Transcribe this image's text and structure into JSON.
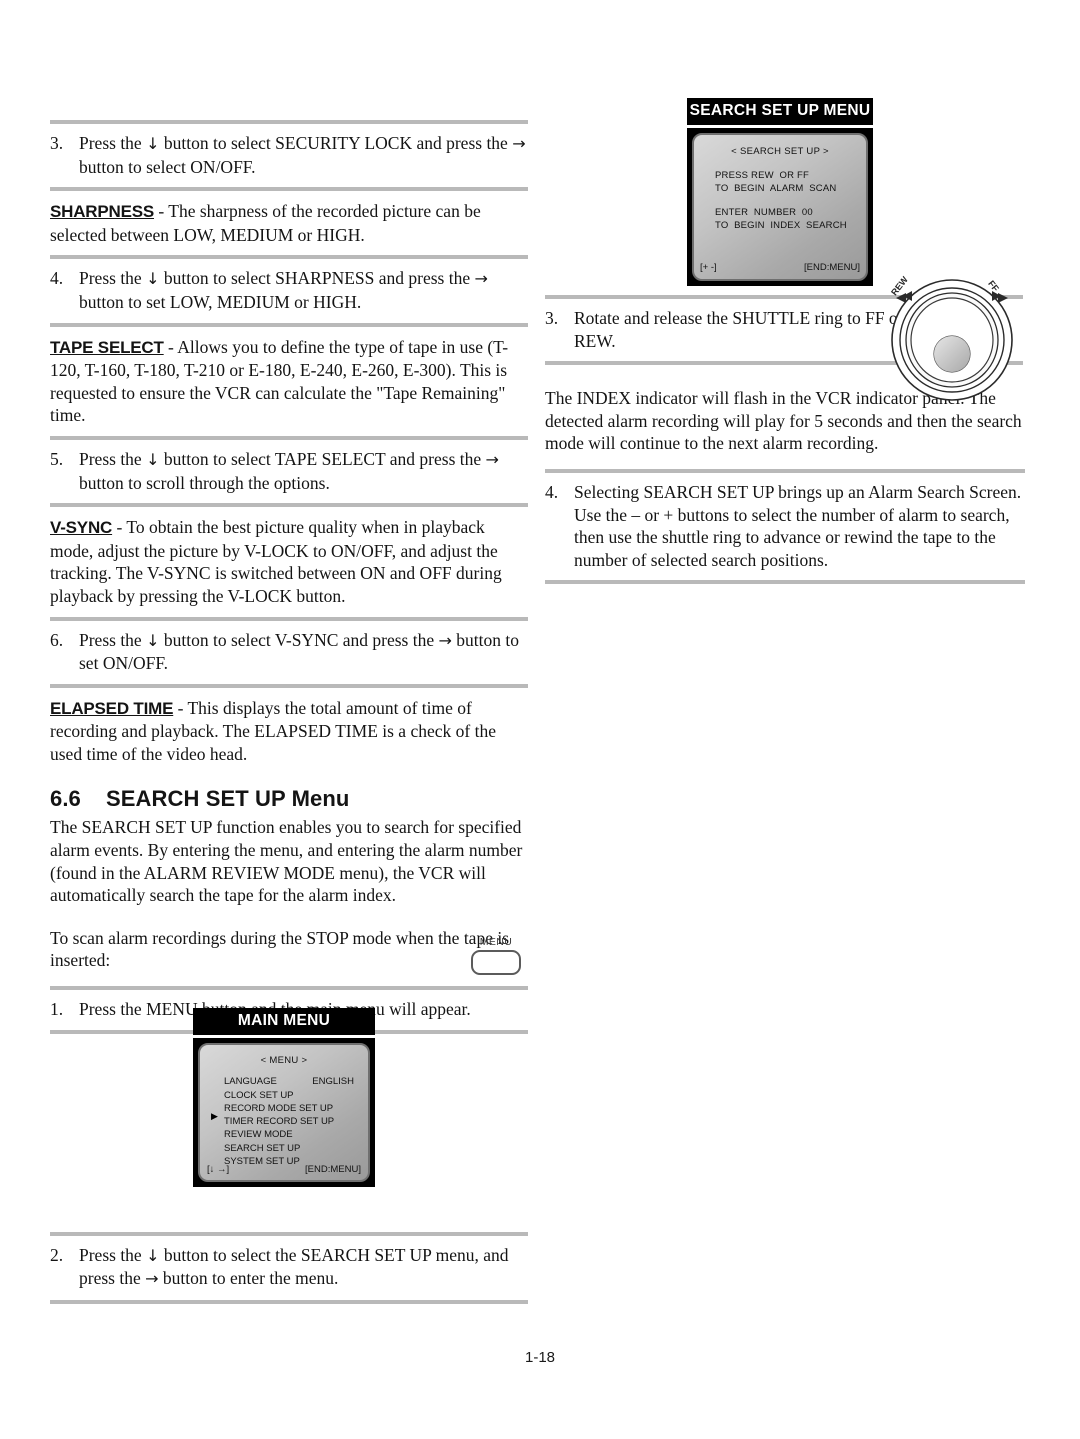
{
  "page": {
    "number": "1-18"
  },
  "left_column": {
    "step3": {
      "num": "3.",
      "text_a": "Press the ",
      "icon_down": "↓",
      "text_b": " button to select SECURITY LOCK and press the ",
      "icon_right": "→",
      "text_c": " button to select ON/OFF."
    },
    "sharpness": {
      "term": "SHARPNESS",
      "body": " - The sharpness of the recorded picture can be selected between LOW, MEDIUM or HIGH."
    },
    "step4": {
      "num": "4.",
      "text_a": "Press the ",
      "icon_down": "↓",
      "text_b": " button to select SHARPNESS and press the ",
      "icon_right": "→",
      "text_c": " button  to set LOW, MEDIUM or HIGH."
    },
    "tape_select": {
      "term": "TAPE SELECT",
      "body": " - Allows you to define the type of tape in use (T-120, T-160, T-180, T-210 or E-180, E-240, E-260, E-300). This is requested to ensure the VCR can calculate the \"Tape Remaining\" time."
    },
    "step5": {
      "num": "5.",
      "text_a": "Press the ",
      "icon_down": "↓",
      "text_b": " button to select TAPE SELECT and press the ",
      "icon_right": "→",
      "text_c": " button to scroll through the options."
    },
    "vsync": {
      "term": "V-SYNC",
      "body": " - To obtain the best picture quality when in playback mode, adjust the picture by V-LOCK to ON/OFF, and adjust the tracking.  The V-SYNC is switched between ON and OFF during playback by pressing the V-LOCK button."
    },
    "step6": {
      "num": "6.",
      "text_a": "Press the ",
      "icon_down": "↓",
      "text_b": " button to select V-SYNC and press the ",
      "icon_right": "→",
      "text_c": " button to set ON/OFF."
    },
    "elapsed_time": {
      "term": "ELAPSED TIME",
      "body": " - This displays the total amount of time of recording and playback. The ELAPSED TIME is a check of the used time of the video head."
    },
    "section": {
      "number": "6.6",
      "title": "SEARCH SET UP Menu",
      "para1": "The SEARCH SET UP function enables you to search for specified alarm events.  By entering the menu, and entering the alarm number (found in the ALARM REVIEW MODE menu), the VCR will automatically search the tape for the alarm index.",
      "para2": "To scan alarm recordings during the STOP mode when the tape is inserted:"
    },
    "step1": {
      "num": "1.",
      "text": "Press the MENU button and the main menu will appear."
    },
    "menu_button": {
      "label": "MENU"
    },
    "step2": {
      "num": "2.",
      "text_a": "Press the ",
      "icon_down": "↓",
      "text_b": " button to select the SEARCH SET UP menu, and press the ",
      "icon_right": "→",
      "text_c": " button to enter the menu."
    }
  },
  "right_column": {
    "step3": {
      "num": "3.",
      "text": "Rotate and release the SHUTTLE ring to FF or REW."
    },
    "index_para": "The INDEX indicator will flash in the VCR indicator panel. The detected alarm recording will play for 5 seconds and then the search mode will continue to the next alarm recording.",
    "step4": {
      "num": "4.",
      "text": "Selecting SEARCH SET UP brings up an Alarm Search Screen. Use the – or + buttons to select the number of alarm to search, then use the shuttle ring to advance or rewind the tape to the number of selected search positions."
    }
  },
  "osd_search": {
    "title": "SEARCH SET UP MENU",
    "header": "< SEARCH SET UP >",
    "line1": "PRESS REW  OR FF",
    "line2": "TO  BEGIN  ALARM  SCAN",
    "line3": "ENTER  NUMBER  00",
    "line4": "TO  BEGIN  INDEX  SEARCH",
    "footer_left": "[+    -]",
    "footer_right": "[END:MENU]"
  },
  "osd_main": {
    "title": "MAIN MENU",
    "header": "< MENU >",
    "items": [
      {
        "label": "LANGUAGE",
        "value": "ENGLISH",
        "selected": false
      },
      {
        "label": "CLOCK  SET  UP",
        "value": "",
        "selected": false
      },
      {
        "label": "RECORD  MODE  SET  UP",
        "value": "",
        "selected": false
      },
      {
        "label": "TIMER  RECORD  SET  UP",
        "value": "",
        "selected": false
      },
      {
        "label": "REVIEW  MODE",
        "value": "",
        "selected": false
      },
      {
        "label": "SEARCH  SET  UP",
        "value": "",
        "selected": true
      },
      {
        "label": "SYSTEM  SET  UP",
        "value": "",
        "selected": false
      }
    ],
    "cursor": "▶",
    "footer_left": "[↓    →]",
    "footer_right": "[END:MENU]"
  },
  "shuttle": {
    "label_rew": "REW",
    "label_ff": "FF"
  }
}
